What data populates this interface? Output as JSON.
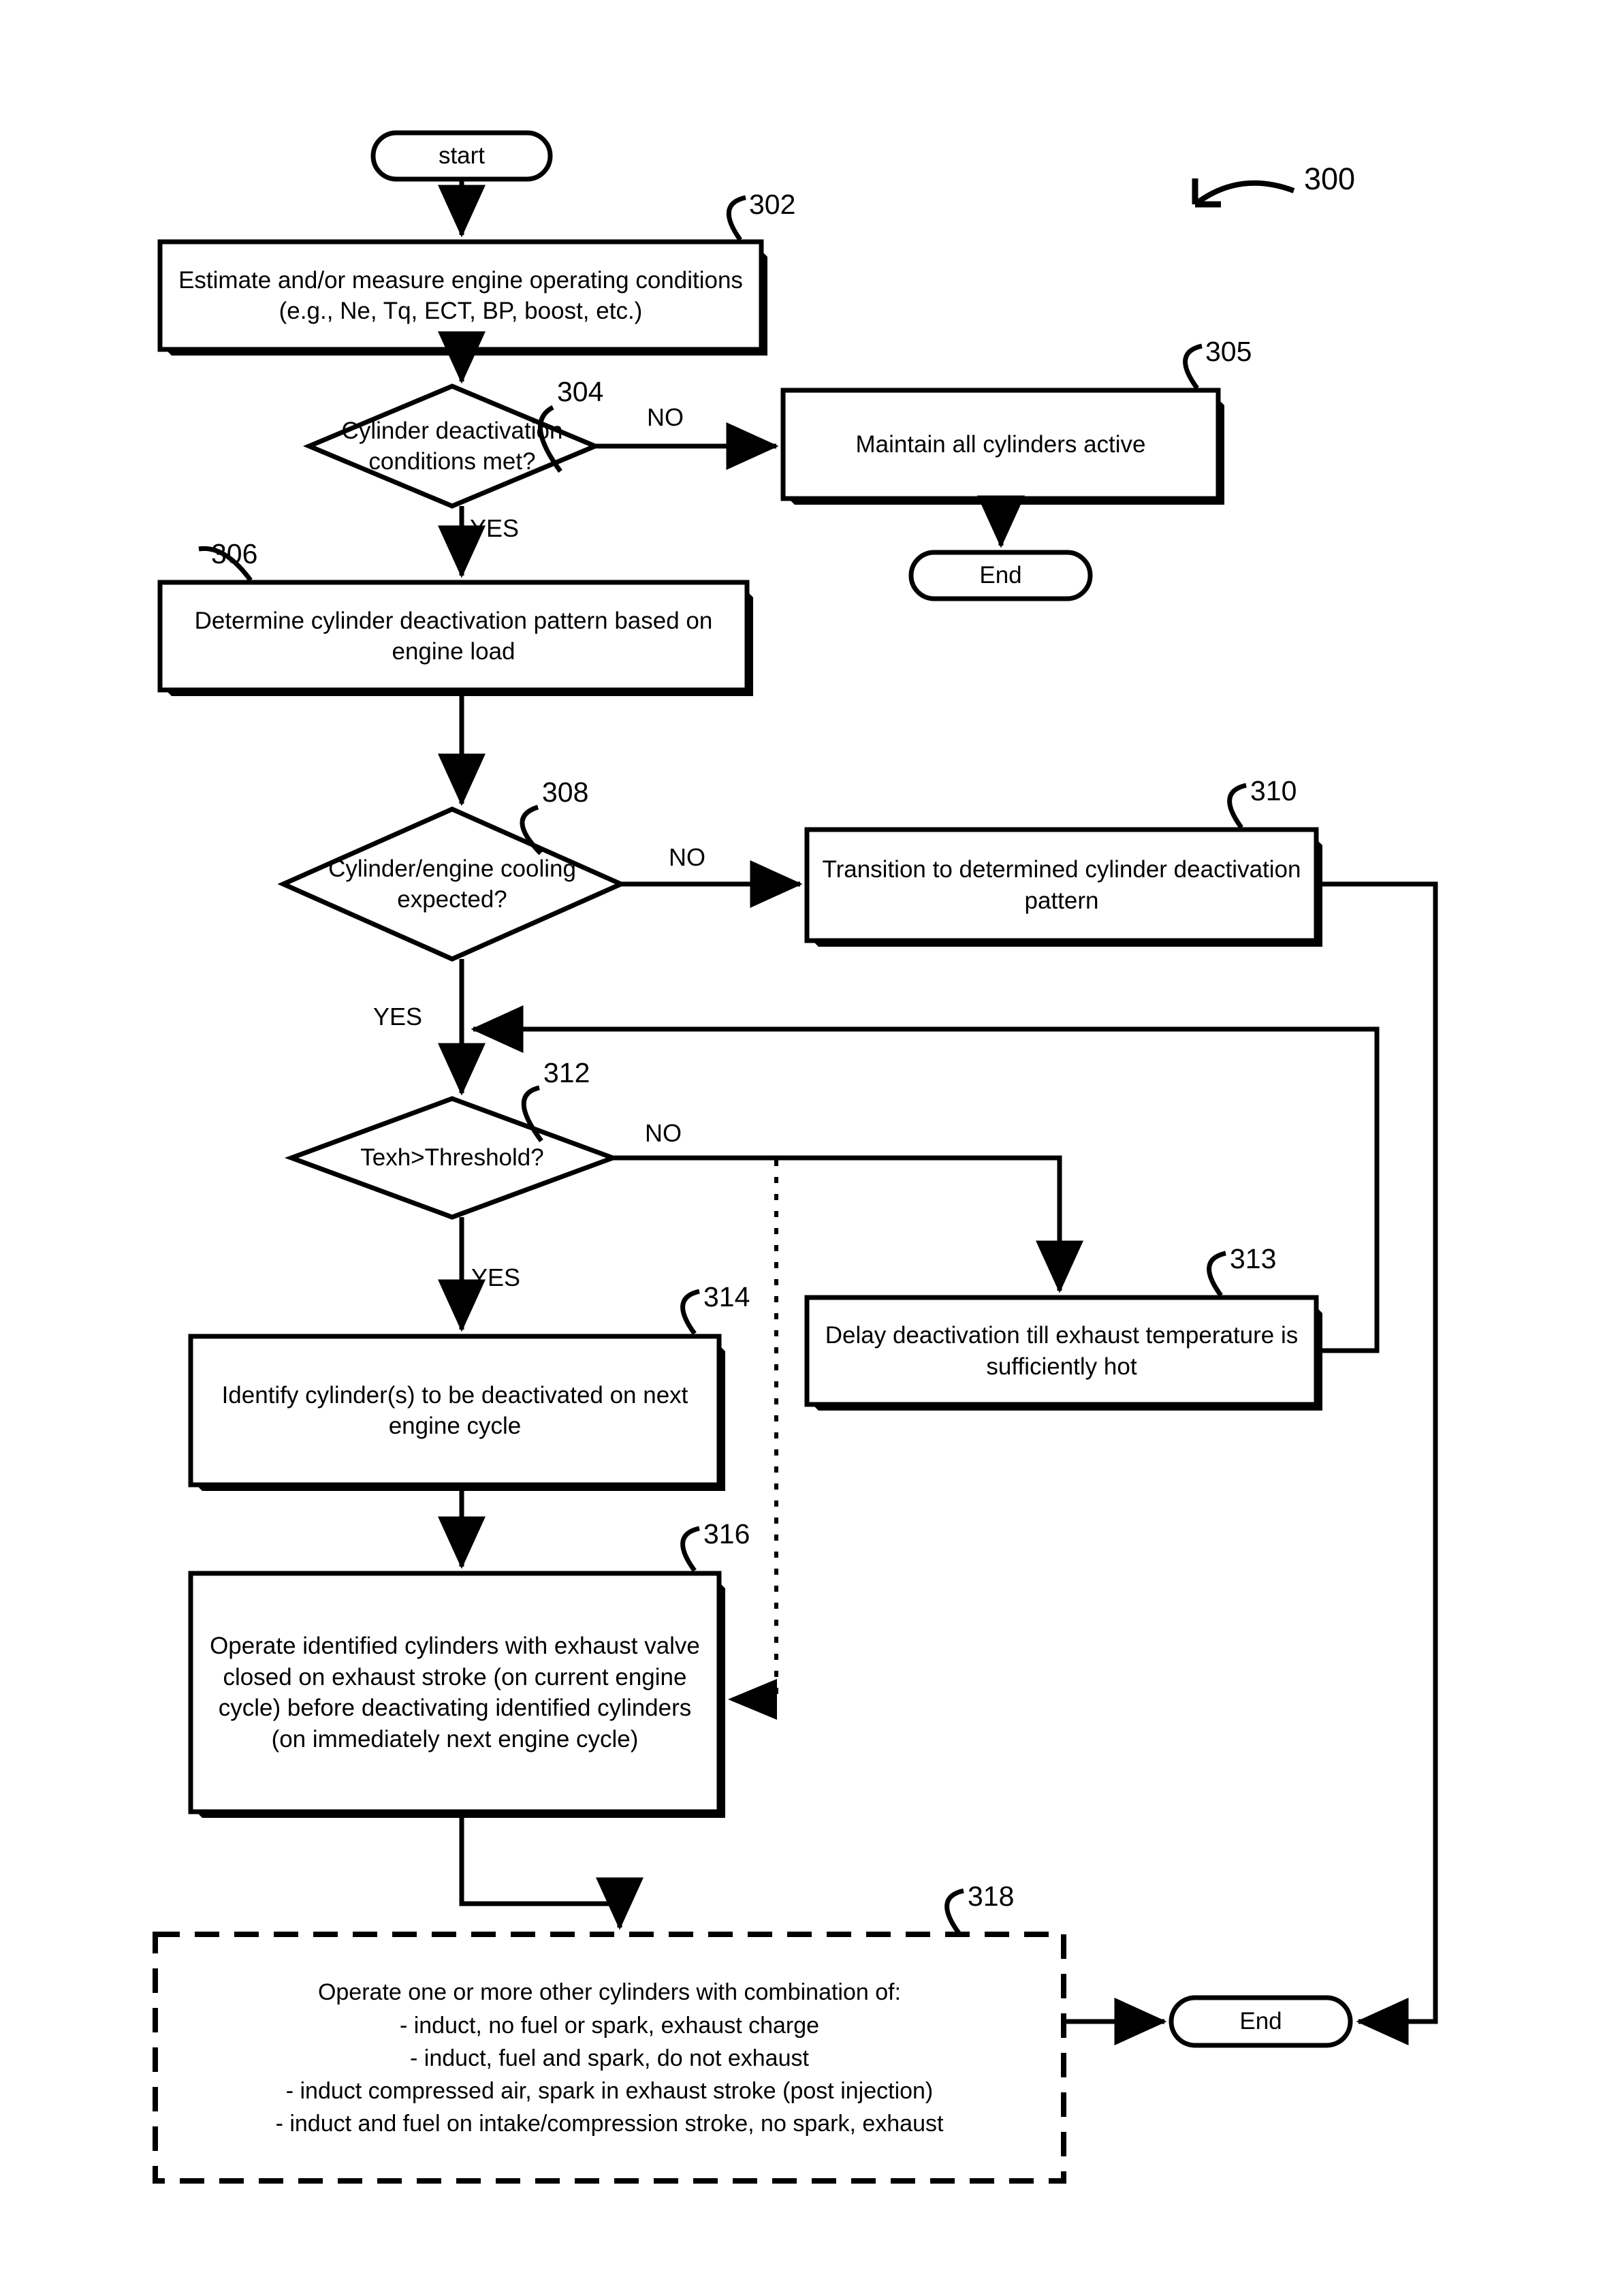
{
  "figure": {
    "figure_ref": "300",
    "nodes": {
      "start": {
        "ref": "",
        "label": "start"
      },
      "n302": {
        "ref": "302",
        "label": "Estimate and/or measure engine operating conditions (e.g., Ne, Tq, ECT, BP, boost, etc.)"
      },
      "n304": {
        "ref": "304",
        "label": "Cylinder deactivation conditions met?"
      },
      "n305": {
        "ref": "305",
        "label": "Maintain all cylinders active"
      },
      "end1": {
        "ref": "",
        "label": "End"
      },
      "n306": {
        "ref": "306",
        "label": "Determine cylinder deactivation pattern based on engine load"
      },
      "n308": {
        "ref": "308",
        "label": "Cylinder/engine cooling expected?"
      },
      "n310": {
        "ref": "310",
        "label": "Transition to determined cylinder deactivation pattern"
      },
      "n312": {
        "ref": "312",
        "label": "Texh>Threshold?"
      },
      "n313": {
        "ref": "313",
        "label": "Delay deactivation till exhaust temperature is sufficiently hot"
      },
      "n314": {
        "ref": "314",
        "label": "Identify cylinder(s) to be deactivated on next engine cycle"
      },
      "n316": {
        "ref": "316",
        "label": "Operate identified cylinders with exhaust valve closed on exhaust stroke (on current engine cycle) before deactivating identified cylinders (on immediately next engine cycle)"
      },
      "n318": {
        "ref": "318",
        "heading": "Operate one or more other cylinders with combination of:",
        "bullets": [
          "- induct, no fuel or spark, exhaust charge",
          "- induct, fuel and spark, do not exhaust",
          "- induct compressed air, spark in exhaust stroke (post injection)",
          "- induct and fuel on intake/compression stroke, no spark, exhaust"
        ]
      },
      "end2": {
        "ref": "",
        "label": "End"
      }
    },
    "edge_labels": {
      "no_304": "NO",
      "yes_304": "YES",
      "no_308": "NO",
      "yes_308": "YES",
      "no_312": "NO",
      "yes_312": "YES"
    },
    "colors": {
      "stroke": "#000000",
      "background": "#ffffff",
      "text": "#000000"
    }
  }
}
